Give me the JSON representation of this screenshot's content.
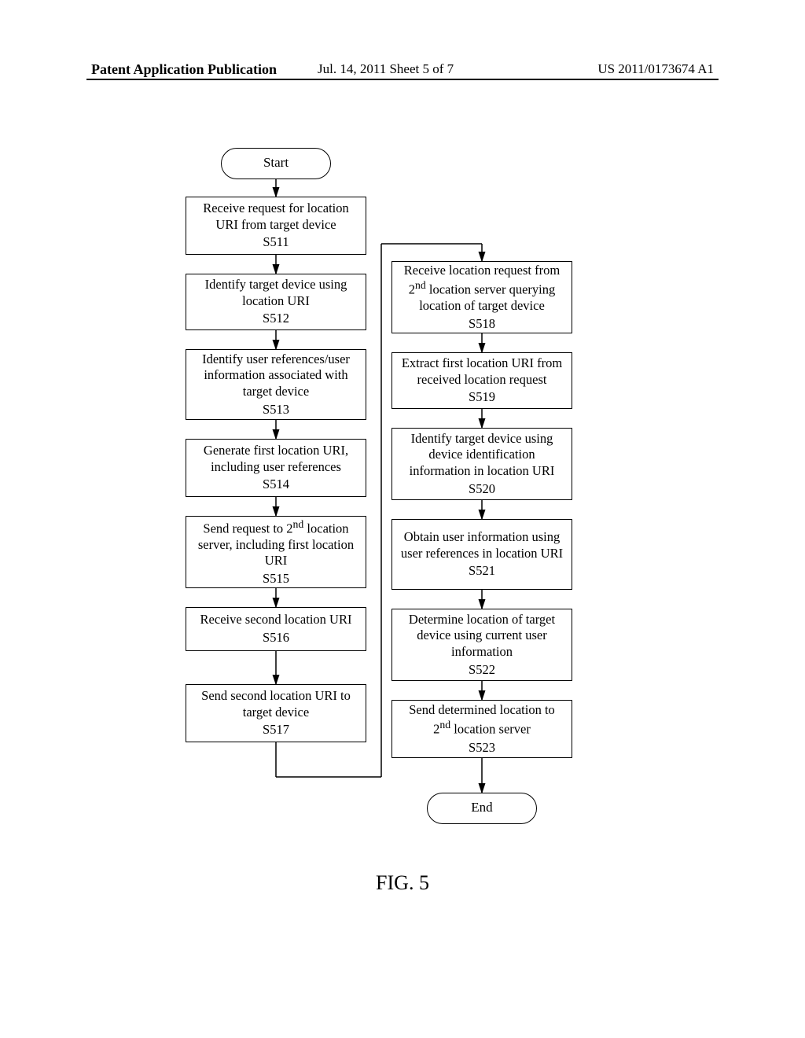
{
  "header": {
    "left": "Patent Application Publication",
    "middle": "Jul. 14, 2011   Sheet 5 of 7",
    "right": "US 2011/0173674 A1"
  },
  "figure_label": "FIG. 5",
  "terminator": {
    "start": "Start",
    "end": "End"
  },
  "left_steps": [
    {
      "text": "Receive request for location URI from target device",
      "id": "S511"
    },
    {
      "text": "Identify target device using location URI",
      "id": "S512"
    },
    {
      "text": "Identify user references/user information associated with target device",
      "id": "S513"
    },
    {
      "text": "Generate first location URI, including user references",
      "id": "S514"
    },
    {
      "text_html": "Send request to 2<sup>nd</sup> location server, including first location URI",
      "id": "S515"
    },
    {
      "text": "Receive second location URI",
      "id": "S516"
    },
    {
      "text": "Send second location URI to target device",
      "id": "S517"
    }
  ],
  "right_steps": [
    {
      "text_html": "Receive location request from 2<sup>nd</sup> location server querying location of target device",
      "id": "S518"
    },
    {
      "text": "Extract first location URI from received location request",
      "id": "S519"
    },
    {
      "text": "Identify target device using device identification information in location URI",
      "id": "S520"
    },
    {
      "text": "Obtain user information using user references in location URI",
      "id": "S521"
    },
    {
      "text": "Determine location of target device using current user information",
      "id": "S522"
    },
    {
      "text_html": "Send determined location to 2<sup>nd</sup> location server",
      "id": "S523"
    }
  ]
}
